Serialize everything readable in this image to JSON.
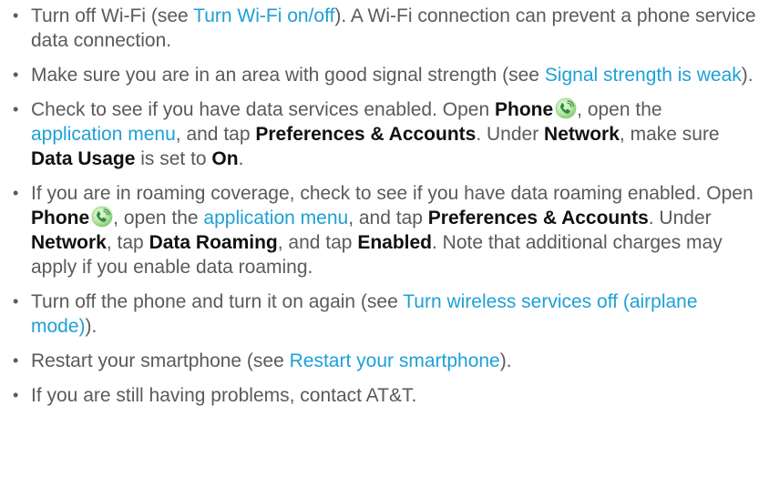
{
  "bullets": [
    {
      "parts": [
        {
          "t": "Turn off Wi-Fi (see "
        },
        {
          "t": "Turn Wi-Fi on/off",
          "link": true
        },
        {
          "t": "). A Wi-Fi connection can prevent a phone service data connection."
        }
      ]
    },
    {
      "parts": [
        {
          "t": "Make sure you are in an area with good signal strength (see "
        },
        {
          "t": "Signal strength is weak",
          "link": true
        },
        {
          "t": ")."
        }
      ]
    },
    {
      "parts": [
        {
          "t": "Check to see if you have data services enabled. Open "
        },
        {
          "t": "Phone",
          "bold": true
        },
        {
          "icon": "phone-icon"
        },
        {
          "t": ", open the "
        },
        {
          "t": "application menu",
          "link": true
        },
        {
          "t": ", and tap "
        },
        {
          "t": "Preferences & Accounts",
          "bold": true
        },
        {
          "t": ". Under "
        },
        {
          "t": "Network",
          "bold": true
        },
        {
          "t": ", make sure "
        },
        {
          "t": "Data Usage",
          "bold": true
        },
        {
          "t": " is set to "
        },
        {
          "t": "On",
          "bold": true
        },
        {
          "t": "."
        }
      ]
    },
    {
      "parts": [
        {
          "t": "If you are in roaming coverage, check to see if you have data roaming enabled. Open "
        },
        {
          "t": "Phone",
          "bold": true
        },
        {
          "icon": "phone-icon"
        },
        {
          "t": ", open the "
        },
        {
          "t": "application menu",
          "link": true
        },
        {
          "t": ", and tap "
        },
        {
          "t": "Preferences & Accounts",
          "bold": true
        },
        {
          "t": ". Under "
        },
        {
          "t": "Network",
          "bold": true
        },
        {
          "t": ", tap "
        },
        {
          "t": "Data Roaming",
          "bold": true
        },
        {
          "t": ", and tap "
        },
        {
          "t": "Enabled",
          "bold": true
        },
        {
          "t": ". Note that additional charges may apply if you enable data roaming."
        }
      ]
    },
    {
      "parts": [
        {
          "t": "Turn off the phone and turn it on again (see "
        },
        {
          "t": "Turn wireless services off (airplane mode)",
          "link": true
        },
        {
          "t": ")."
        }
      ]
    },
    {
      "parts": [
        {
          "t": "Restart your smartphone (see "
        },
        {
          "t": "Restart your smartphone",
          "link": true
        },
        {
          "t": ")."
        }
      ]
    },
    {
      "parts": [
        {
          "t": "If you are still having problems, contact AT&T."
        }
      ]
    }
  ],
  "colors": {
    "text": "#5a5a5a",
    "link": "#1ea0d6",
    "bold": "#111111"
  }
}
